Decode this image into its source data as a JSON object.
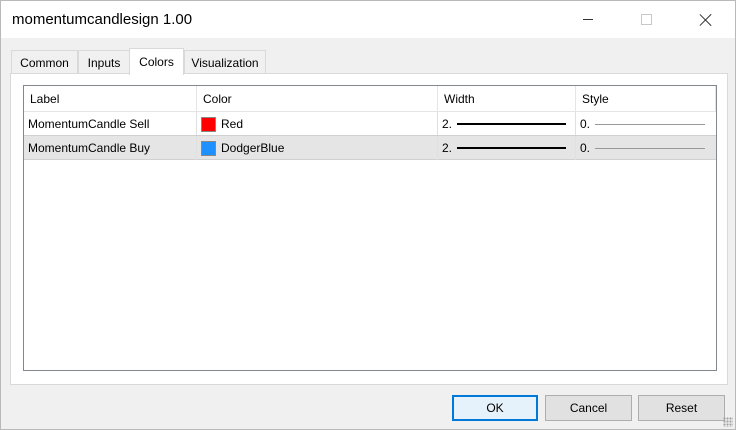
{
  "window": {
    "title": "momentumcandlesign 1.00"
  },
  "tabs": [
    {
      "label": "Common",
      "active": false
    },
    {
      "label": "Inputs",
      "active": false
    },
    {
      "label": "Colors",
      "active": true
    },
    {
      "label": "Visualization",
      "active": false
    }
  ],
  "table": {
    "columns": [
      "Label",
      "Color",
      "Width",
      "Style"
    ],
    "rows": [
      {
        "label": "MomentumCandle Sell",
        "color_name": "Red",
        "color_hex": "#ff0000",
        "width": "2.",
        "style": "0.",
        "selected": false
      },
      {
        "label": "MomentumCandle Buy",
        "color_name": "DodgerBlue",
        "color_hex": "#1e90ff",
        "width": "2.",
        "style": "0.",
        "selected": true
      }
    ]
  },
  "buttons": {
    "ok": "OK",
    "cancel": "Cancel",
    "reset": "Reset"
  }
}
